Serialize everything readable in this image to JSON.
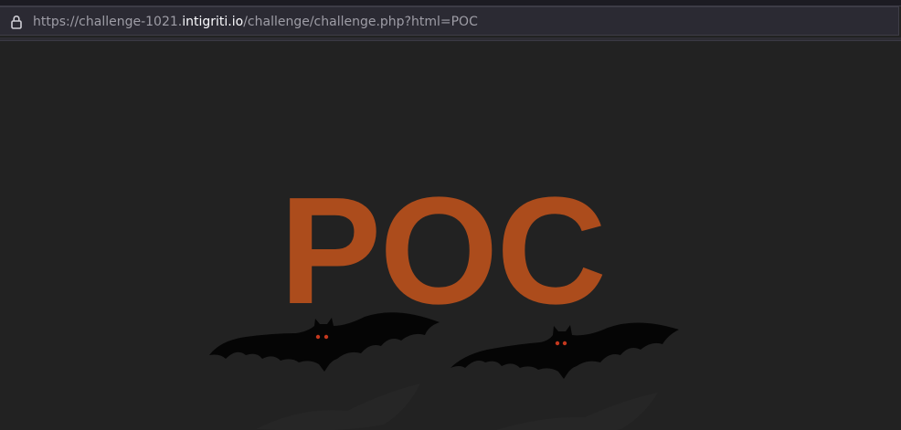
{
  "browser": {
    "url_prefix": "https://challenge-1021.",
    "url_host": "intigriti.io",
    "url_path": "/challenge/challenge.php?html=POC",
    "lock_icon": "lock-icon"
  },
  "page": {
    "injected_text": "POC",
    "text_color": "#ac4c1c",
    "background_color": "#222222"
  },
  "decorations": {
    "bat_left": "bat-icon",
    "bat_right": "bat-icon"
  }
}
